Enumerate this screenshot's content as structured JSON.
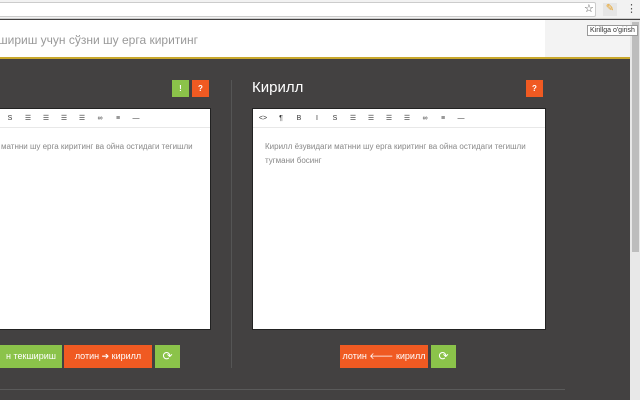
{
  "browser": {
    "tooltip": "Kirillga o'girish",
    "star_icon": "☆",
    "menu_icon": "⋮",
    "extension_icon": "✎"
  },
  "header": {
    "text": "шириш учун сўзни шу ерга киритинг"
  },
  "left_panel": {
    "info_label": "!",
    "help_label": "?",
    "toolbar": [
      "S",
      "☰",
      "☰",
      "☰",
      "☰",
      "∞",
      "≡",
      "—"
    ],
    "text": "матнни шу ерга киритинг ва ойна остидаги тегишли",
    "check_button": "н текшириш",
    "convert_button": "лотин ➔ кирилл",
    "refresh_icon": "⟳"
  },
  "right_panel": {
    "title": "Кирилл",
    "help_label": "?",
    "toolbar": [
      "<>",
      "¶",
      "B",
      "I",
      "S",
      "☰",
      "☰",
      "☰",
      "☰",
      "∞",
      "≡",
      "—"
    ],
    "text": "Кирилл ёзувидаги матнни шу ерга киритинг ва ойна остидаги тегишли тугмани босинг",
    "convert_button": "лотин 🡐 кирилл",
    "refresh_icon": "⟳"
  }
}
